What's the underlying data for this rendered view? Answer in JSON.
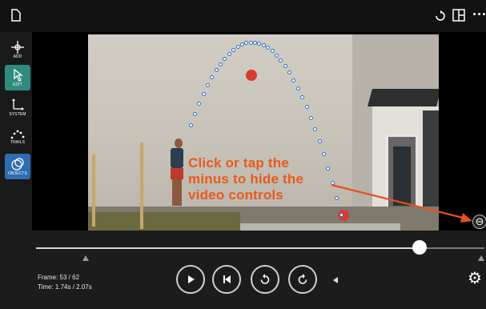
{
  "toolbar": {
    "tools": [
      {
        "key": "add",
        "label": "ADD",
        "icon": "crosshair-add-icon"
      },
      {
        "key": "edit",
        "label": "EDIT",
        "icon": "pointer-edit-icon"
      },
      {
        "key": "system",
        "label": "SYSTEM",
        "icon": "axes-system-icon"
      },
      {
        "key": "trails",
        "label": "TRAILS",
        "icon": "trail-dots-icon"
      },
      {
        "key": "objects",
        "label": "OBJECTS",
        "icon": "objects-icon"
      }
    ],
    "active_tool": "objects"
  },
  "topbar": {
    "left_icon": "document-icon",
    "right_icons": [
      "undo-icon",
      "layout-icon",
      "more-icon"
    ]
  },
  "annotation": {
    "line1": "Click or tap the",
    "line2": "minus to hide the",
    "line3": "video controls",
    "color": "#e85a1c"
  },
  "controls": {
    "frame_label": "Frame: 53 / 62",
    "time_label": "Time: 1.74s / 2.07s",
    "current_frame": 53,
    "total_frames": 62,
    "hide_button_glyph": "⊖",
    "buttons": [
      "play-button",
      "step-back-button",
      "rewind-button",
      "replay-button"
    ]
  },
  "colors": {
    "edit_tool": "#2e8b7d",
    "objects_tool": "#2f6db3",
    "trail_outline": "#2b6cc4"
  }
}
